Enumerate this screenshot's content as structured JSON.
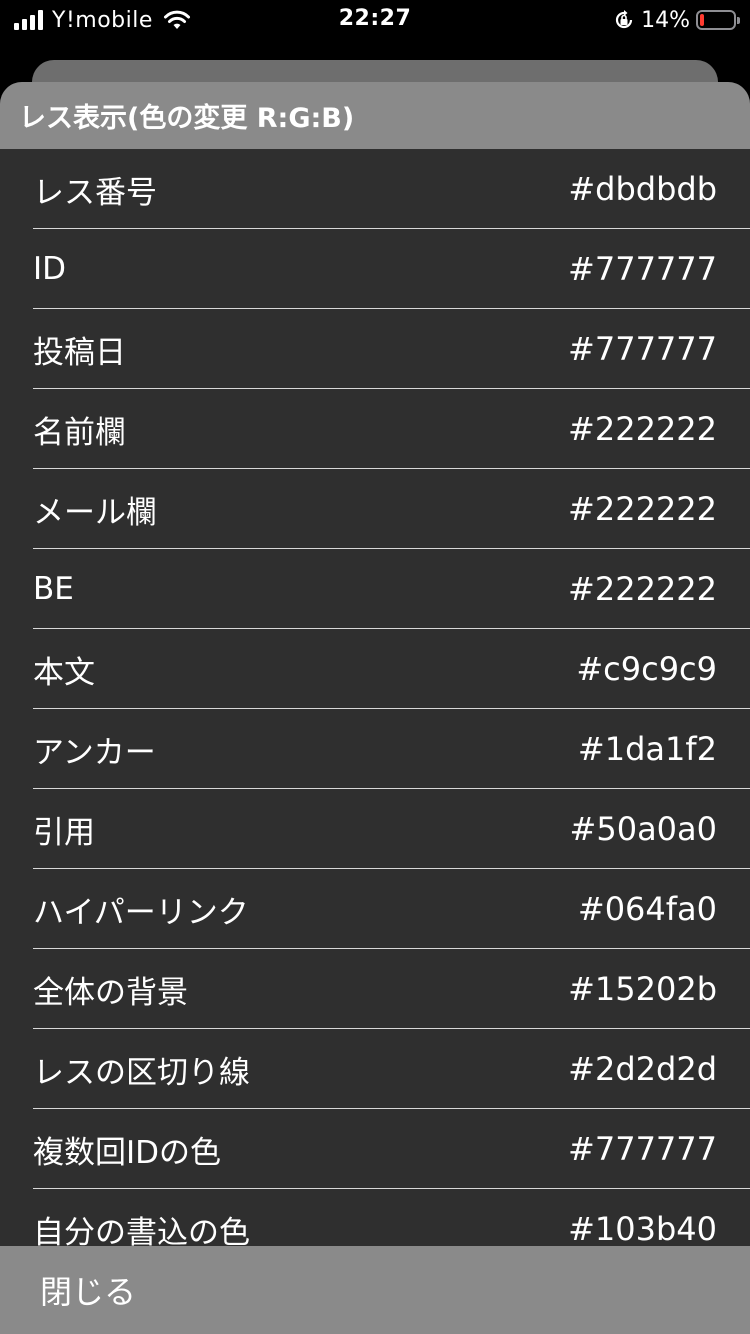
{
  "status_bar": {
    "carrier": "Y!mobile",
    "time": "22:27",
    "battery_percent": "14%",
    "battery_level": 0.14,
    "battery_color": "#ff3b30",
    "icons": [
      "signal-icon",
      "wifi-icon",
      "orientation-lock-icon",
      "battery-icon"
    ]
  },
  "sheet": {
    "title": "レス表示(色の変更 R:G:B)",
    "header_color": "#8a8a8a",
    "background_color": "#2f2f2f",
    "rows": [
      {
        "label": "レス番号",
        "value": "#dbdbdb"
      },
      {
        "label": "ID",
        "value": "#777777"
      },
      {
        "label": "投稿日",
        "value": "#777777"
      },
      {
        "label": "名前欄",
        "value": "#222222"
      },
      {
        "label": "メール欄",
        "value": "#222222"
      },
      {
        "label": "BE",
        "value": "#222222"
      },
      {
        "label": "本文",
        "value": "#c9c9c9"
      },
      {
        "label": "アンカー",
        "value": "#1da1f2"
      },
      {
        "label": "引用",
        "value": "#50a0a0"
      },
      {
        "label": "ハイパーリンク",
        "value": "#064fa0"
      },
      {
        "label": "全体の背景",
        "value": "#15202b"
      },
      {
        "label": "レスの区切り線",
        "value": "#2d2d2d"
      },
      {
        "label": "複数回IDの色",
        "value": "#777777"
      },
      {
        "label": "自分の書込の色",
        "value": "#103b40"
      }
    ]
  },
  "footer": {
    "close_label": "閉じる"
  }
}
